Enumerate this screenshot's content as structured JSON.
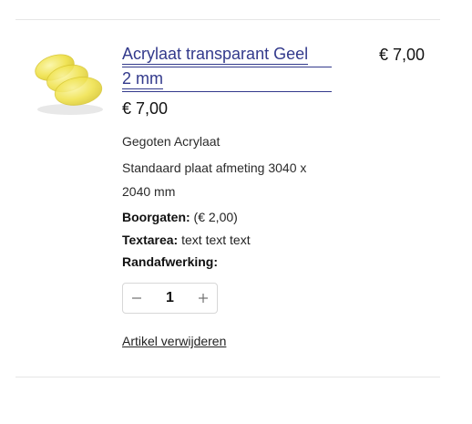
{
  "item": {
    "title_line1": "Acrylaat transparant Geel",
    "title_line2": "2 mm",
    "unit_price": "€ 7,00",
    "line_total": "€ 7,00",
    "material": "Gegoten Acrylaat",
    "size_line1": "Standaard plaat afmeting 3040 x",
    "size_line2": "2040 mm",
    "options": [
      {
        "label": "Boorgaten:",
        "value": " (€ 2,00)"
      },
      {
        "label": "Textarea:",
        "value": " text text text"
      },
      {
        "label": "Randafwerking:",
        "value": ""
      }
    ],
    "quantity": "1",
    "remove_label": "Artikel verwijderen"
  },
  "icons": {
    "decrease": "minus-icon",
    "increase": "plus-icon"
  },
  "colors": {
    "link": "#333a8c",
    "product_yellow": "#f2e33a"
  }
}
